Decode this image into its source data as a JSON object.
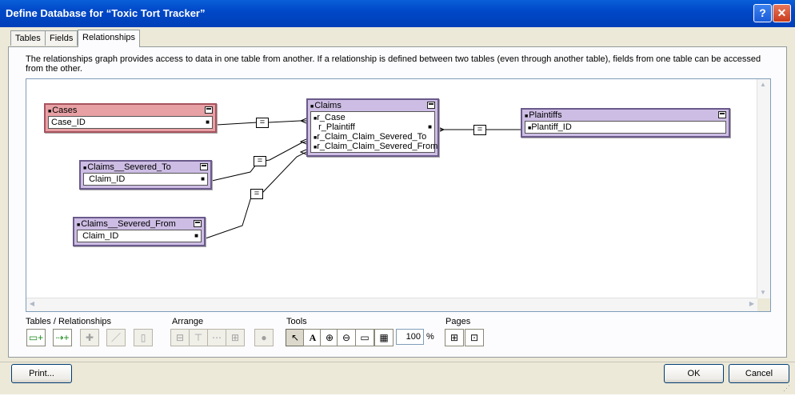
{
  "window": {
    "title": "Define Database for “Toxic Tort Tracker”",
    "help_label": "?",
    "close_label": "✕"
  },
  "tabs": [
    {
      "label": "Tables"
    },
    {
      "label": "Fields"
    },
    {
      "label": "Relationships"
    }
  ],
  "description": "The relationships graph provides access to data in one table from another. If a relationship is defined between two tables (even through another table), fields from one table can be accessed from the other.",
  "graph": {
    "tables": {
      "cases": {
        "name": "Cases",
        "fields": [
          "Case_ID"
        ]
      },
      "claims": {
        "name": "Claims",
        "fields": [
          "r_Case",
          "r_Plaintiff",
          "r_Claim_Claim_Severed_To",
          "r_Claim_Claim_Severed_From"
        ]
      },
      "plaintiffs": {
        "name": "Plaintiffs",
        "fields": [
          "Plantiff_ID"
        ]
      },
      "severed_to": {
        "name": "Claims__Severed_To",
        "fields": [
          "Claim_ID"
        ]
      },
      "severed_from": {
        "name": "Claims__Severed_From",
        "fields": [
          "Claim_ID"
        ]
      }
    },
    "relationship_operator": "="
  },
  "toolbar": {
    "groups": [
      "Tables / Relationships",
      "Arrange",
      "Tools",
      "Pages"
    ],
    "zoom_value": "100",
    "zoom_unit": "%",
    "icons": {
      "tables_relationships": [
        "add-table-icon",
        "add-relationship-icon",
        "duplicate-icon",
        "edit-icon",
        "delete-icon"
      ],
      "arrange": [
        "align-left-icon",
        "align-top-icon",
        "distribute-horizontal-icon",
        "resize-icon",
        "color-icon"
      ],
      "tools": [
        "pointer-icon",
        "text-icon",
        "zoom-in-icon",
        "zoom-out-icon",
        "fit-window-icon",
        "page-view-icon"
      ],
      "pages": [
        "page-breaks-icon",
        "page-setup-icon"
      ]
    }
  },
  "buttons": {
    "print": "Print...",
    "ok": "OK",
    "cancel": "Cancel"
  },
  "colors": {
    "title_bar": "#0048c8",
    "cases_table": "#e7a0a4",
    "table_occurrence": "#cdbde4"
  }
}
